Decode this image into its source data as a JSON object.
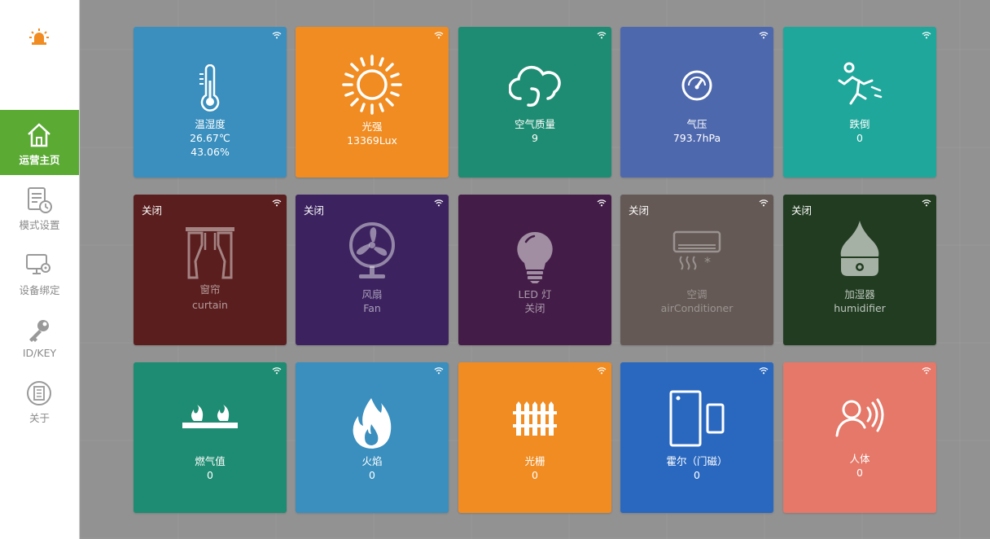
{
  "sidebar": {
    "items": [
      {
        "label": "运营主页",
        "icon": "home-icon",
        "active": true
      },
      {
        "label": "模式设置",
        "icon": "document-clock-icon",
        "active": false
      },
      {
        "label": "设备绑定",
        "icon": "monitor-gear-icon",
        "active": false
      },
      {
        "label": "ID/KEY",
        "icon": "key-icon",
        "active": false
      },
      {
        "label": "关于",
        "icon": "building-icon",
        "active": false
      }
    ]
  },
  "tiles": {
    "temp": {
      "name": "温湿度",
      "v1": "26.67℃",
      "v2": "43.06%",
      "color": "#3a8fbe"
    },
    "light": {
      "name": "光强",
      "v1": "13369Lux",
      "color": "#f08c21"
    },
    "air": {
      "name": "空气质量",
      "v1": "9",
      "color": "#1e8c72"
    },
    "pressure": {
      "name": "气压",
      "v1": "793.7hPa",
      "color": "#4e68ad"
    },
    "fall": {
      "name": "跌倒",
      "v1": "0",
      "color": "#1fa79b"
    },
    "curtain": {
      "status": "关闭",
      "name": "窗帘",
      "sub": "curtain",
      "color": "#5a1e1e"
    },
    "fan": {
      "status": "关闭",
      "name": "风扇",
      "sub": "Fan",
      "color": "#3c235f"
    },
    "led": {
      "status": "",
      "name": "LED 灯",
      "sub": "关闭",
      "color": "#431d47"
    },
    "ac": {
      "status": "关闭",
      "name": "空调",
      "sub": "airConditioner",
      "color": "#645955"
    },
    "humid": {
      "status": "关闭",
      "name": "加湿器",
      "sub": "humidifier",
      "color": "#213c20"
    },
    "gas": {
      "name": "燃气值",
      "v1": "0",
      "color": "#1e8c72"
    },
    "flame": {
      "name": "火焰",
      "v1": "0",
      "color": "#3a8fbe"
    },
    "grating": {
      "name": "光栅",
      "v1": "0",
      "color": "#f08c21"
    },
    "hall": {
      "name": "霍尔（门磁）",
      "v1": "0",
      "color": "#2a68bf"
    },
    "body": {
      "name": "人体",
      "v1": "0",
      "color": "#e57868"
    }
  }
}
